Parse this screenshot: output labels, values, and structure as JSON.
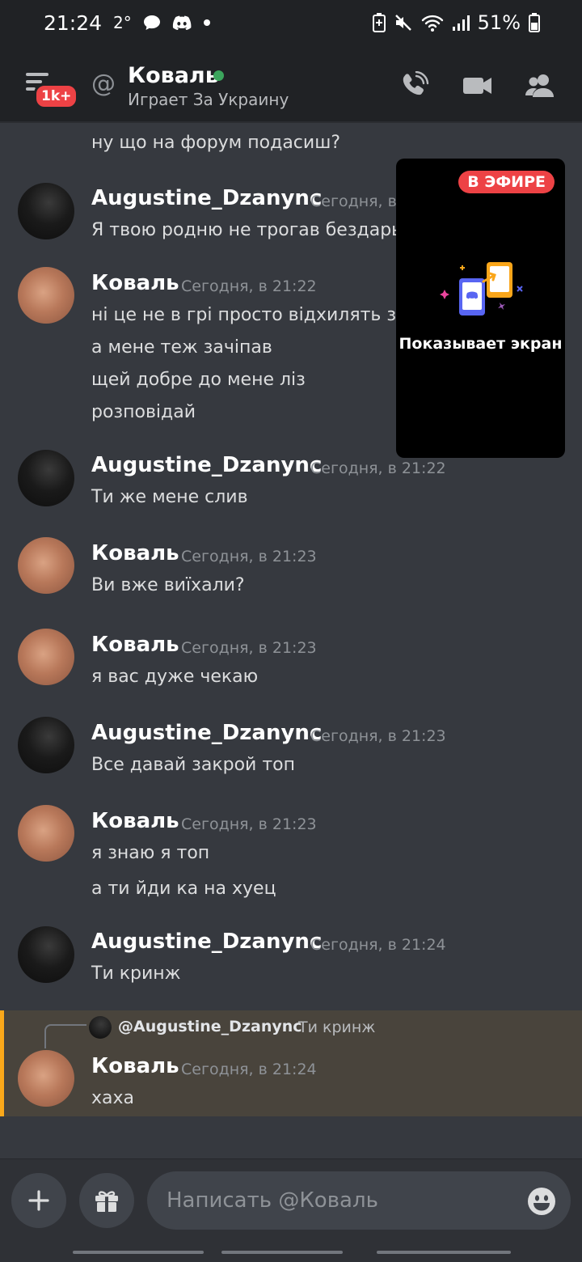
{
  "status_bar": {
    "time": "21:24",
    "temperature": "2°",
    "battery": "51%"
  },
  "header": {
    "unread_badge": "1k+",
    "at_symbol": "@",
    "channel_name": "Коваль",
    "activity": "Играет За Украину"
  },
  "stream": {
    "live_label": "В ЭФИРЕ",
    "sharing_text": "Показывает экран"
  },
  "messages": {
    "partial_line": "ну що на форум подасиш?",
    "groups": [
      {
        "author": "Augustine_Dzanync",
        "timestamp": "Сегодня, в",
        "lines": [
          "Я твою родню не трогав бездарь"
        ]
      },
      {
        "author": "Коваль",
        "timestamp": "Сегодня, в 21:22",
        "lines": [
          "ні це не в грі просто відхилять за",
          "а мене теж зачіпав",
          "щей добре до мене ліз",
          "розповідай"
        ]
      },
      {
        "author": "Augustine_Dzanync",
        "timestamp": "Сегодня, в 21:22",
        "lines": [
          "Ти же мене слив"
        ]
      },
      {
        "author": "Коваль",
        "timestamp": "Сегодня, в 21:23",
        "lines": [
          "Ви вже виїхали?"
        ]
      },
      {
        "author": "Коваль",
        "timestamp": "Сегодня, в 21:23",
        "lines": [
          "я вас дуже чекаю"
        ]
      },
      {
        "author": "Augustine_Dzanync",
        "timestamp": "Сегодня, в 21:23",
        "lines": [
          "Все давай закрой топ"
        ]
      },
      {
        "author": "Коваль",
        "timestamp": "Сегодня, в 21:23",
        "lines": [
          "я знаю я топ",
          "а ти йди ка на хуец"
        ]
      },
      {
        "author": "Augustine_Dzanync",
        "timestamp": "Сегодня, в 21:24",
        "lines": [
          "Ти кринж"
        ]
      },
      {
        "author": "Коваль",
        "timestamp": "Сегодня, в 21:24",
        "lines": [
          "хаха"
        ]
      }
    ],
    "reply": {
      "author": "@Augustine_Dzanync",
      "text": "Ти кринж"
    }
  },
  "composer": {
    "placeholder": "Написать @Коваль"
  },
  "colors": {
    "background": "#36393f",
    "header": "#202225",
    "live_red": "#ed4245",
    "online_green": "#3ba55c",
    "mention_highlight": "#49443c",
    "mention_bar": "#faa81a"
  },
  "icons": [
    "notification-chat-icon",
    "discord-icon",
    "wifi-icon",
    "signal-icon",
    "mute-icon",
    "call-icon",
    "video-icon",
    "members-icon",
    "plus-icon",
    "gift-icon",
    "emoji-icon"
  ]
}
